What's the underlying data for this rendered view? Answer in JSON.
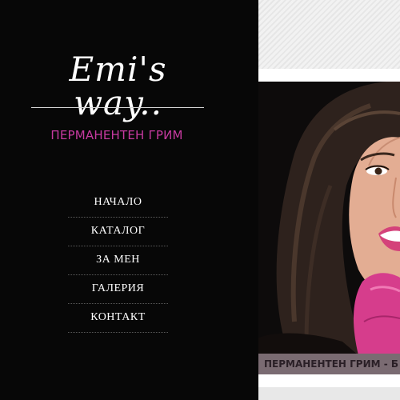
{
  "brand": {
    "logo_text": "Emi's way..",
    "tagline": "ПЕРМАНЕНТЕН ГРИМ"
  },
  "nav": {
    "items": [
      {
        "label": "НАЧАЛО"
      },
      {
        "label": "КАТАЛОГ"
      },
      {
        "label": "ЗА МЕН"
      },
      {
        "label": "ГАЛЕРИЯ"
      },
      {
        "label": "КОНТАКТ"
      }
    ]
  },
  "hero": {
    "caption": "ПЕРМАНЕНТЕН ГРИМ - Б"
  },
  "colors": {
    "sidebar_bg": "#070707",
    "accent_pink": "#c63aa0",
    "caption_bar": "#7a6b72",
    "glove_pink": "#d63d8c"
  }
}
